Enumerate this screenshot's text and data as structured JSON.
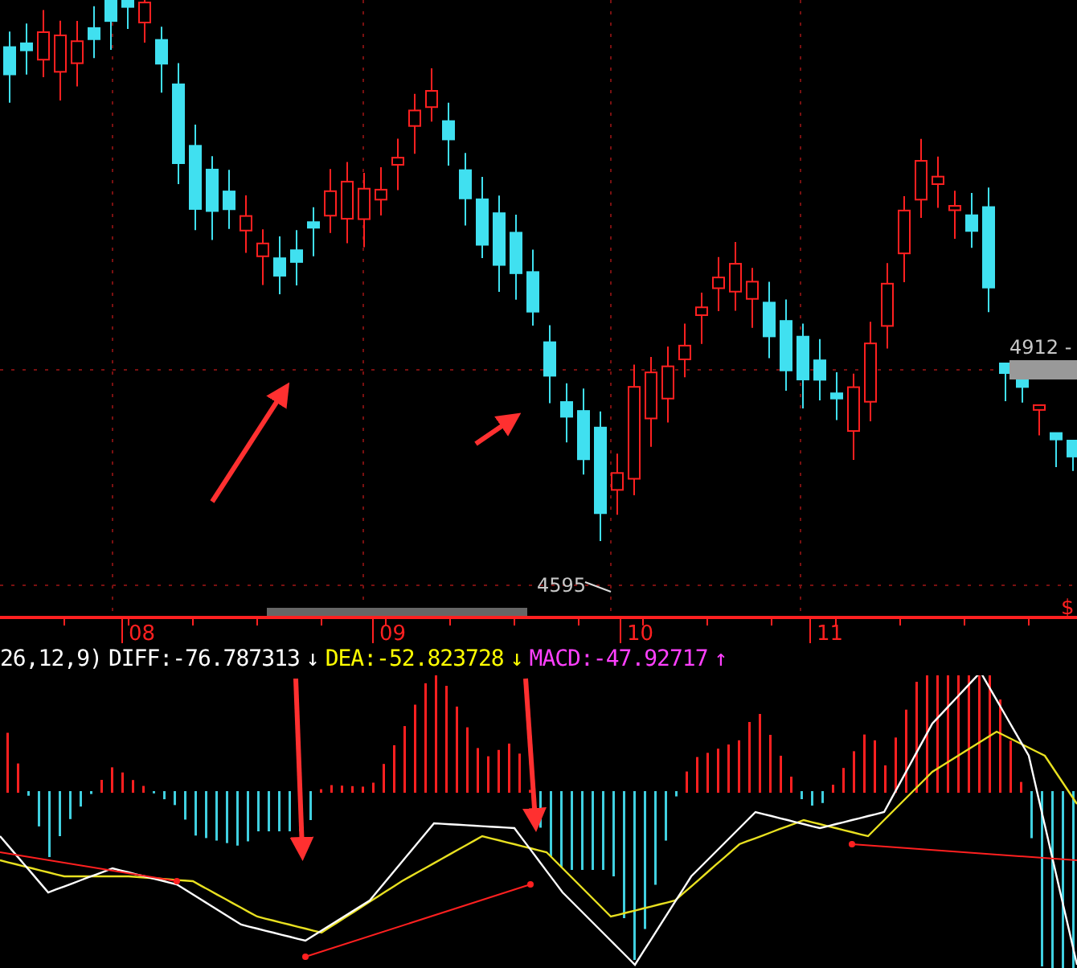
{
  "price_chart": {
    "low_label": "4595",
    "last_price_label": "4912 -"
  },
  "time_axis": {
    "months": [
      "08",
      "09",
      "10",
      "11"
    ],
    "corner_mark": "$"
  },
  "indicator": {
    "params": "26,12,9)",
    "diff": "DIFF:-76.787313",
    "diff_trend": "↓",
    "dea": "DEA:-52.823728",
    "dea_trend": "↓",
    "macd": "MACD:-47.92717",
    "macd_trend": "↑"
  }
}
